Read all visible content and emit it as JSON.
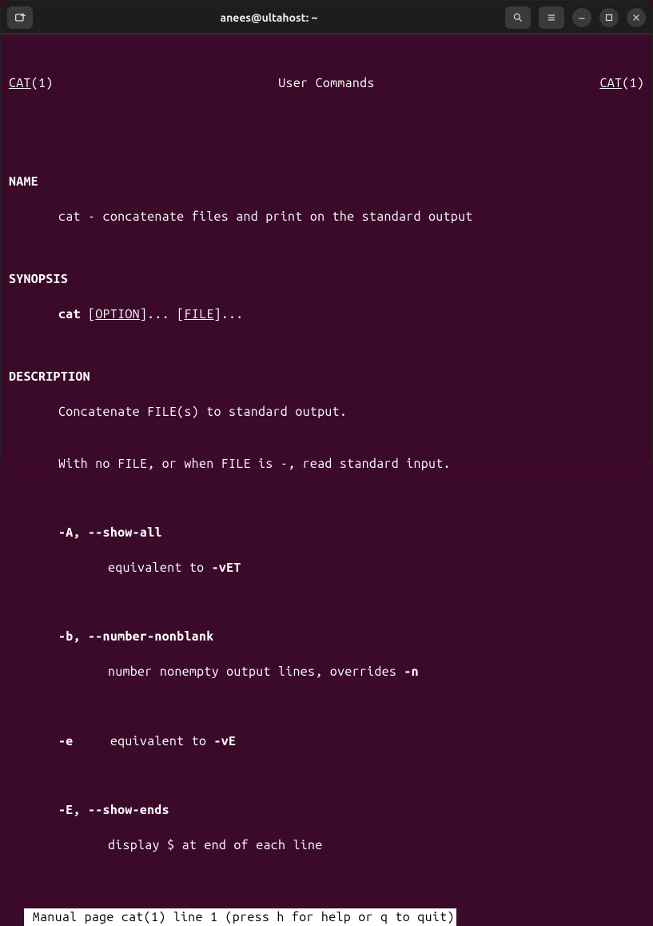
{
  "titlebar": {
    "title": "anees@ultahost: ~"
  },
  "manpage": {
    "header": {
      "left_name": "CAT",
      "left_section": "(1)",
      "center": "User Commands",
      "right_name": "CAT",
      "right_section": "(1)"
    },
    "name": {
      "heading": "NAME",
      "text": "cat - concatenate files and print on the standard output"
    },
    "synopsis": {
      "heading": "SYNOPSIS",
      "cmd": "cat",
      "opt_open": " [",
      "opt_label": "OPTION",
      "opt_close": "]... [",
      "file_label": "FILE",
      "file_close": "]..."
    },
    "description": {
      "heading": "DESCRIPTION",
      "line1": "Concatenate FILE(s) to standard output.",
      "line2": "With no FILE, or when FILE is -, read standard input.",
      "optA": {
        "flags": "-A, --show-all",
        "desc_prefix": "equivalent to ",
        "desc_bold": "-vET"
      },
      "optb": {
        "flags": "-b, --number-nonblank",
        "desc_prefix": "number nonempty output lines, overrides ",
        "desc_bold": "-n"
      },
      "opte": {
        "flag": "-e",
        "desc_prefix": "     equivalent to ",
        "desc_bold": "-vE"
      },
      "optE": {
        "flags": "-E, --show-ends",
        "desc": "display $ at end of each line"
      }
    },
    "status": " Manual page cat(1) line 1 (press h for help or q to quit)"
  }
}
